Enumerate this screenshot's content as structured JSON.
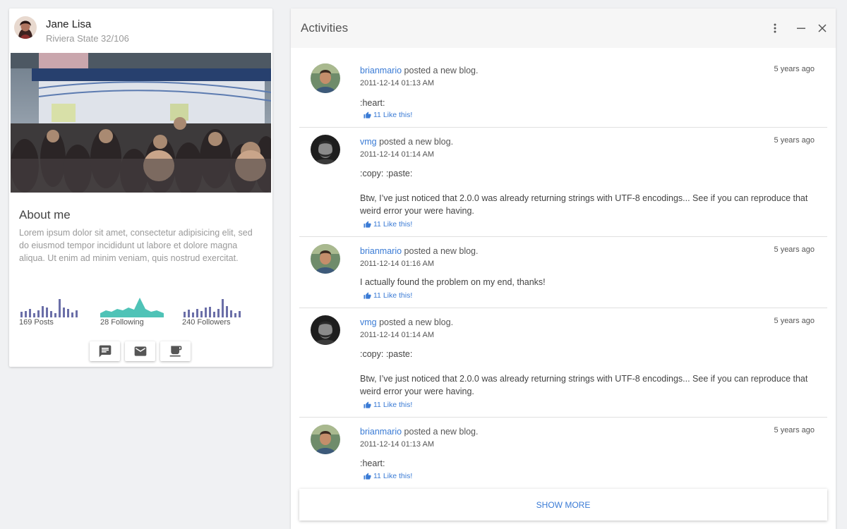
{
  "profile": {
    "name": "Jane Lisa",
    "address": "Riviera State 32/106",
    "about_title": "About me",
    "about_text": "Lorem ipsum dolor sit amet, consectetur adipisicing elit, sed do eiusmod tempor incididunt ut labore et dolore magna aliqua. Ut enim ad minim veniam, quis nostrud exercitat.",
    "stats": {
      "posts": "169 Posts",
      "following": "28 Following",
      "followers": "240 Followers"
    },
    "actions": [
      {
        "icon": "chat-icon"
      },
      {
        "icon": "mail-icon"
      },
      {
        "icon": "coffee-icon"
      }
    ]
  },
  "activities": {
    "title": "Activities",
    "items": [
      {
        "user": "brianmario",
        "action": " posted a new blog.",
        "time": "5 years ago",
        "date": "2011-12-14 01:13 AM",
        "body": ":heart:",
        "likes": "11 Like this!"
      },
      {
        "user": "vmg",
        "action": " posted a new blog.",
        "time": "5 years ago",
        "date": "2011-12-14 01:14 AM",
        "body": ":copy: :paste:",
        "body2": "Btw, I’ve just noticed that 2.0.0 was already returning strings with UTF-8 encodings... See if you can reproduce that weird error your were having.",
        "likes": "11 Like this!"
      },
      {
        "user": "brianmario",
        "action": " posted a new blog.",
        "time": "5 years ago",
        "date": "2011-12-14 01:16 AM",
        "body": "I actually found the problem on my end, thanks!",
        "likes": "11 Like this!"
      },
      {
        "user": "vmg",
        "action": " posted a new blog.",
        "time": "5 years ago",
        "date": "2011-12-14 01:14 AM",
        "body": ":copy: :paste:",
        "body2": "Btw, I’ve just noticed that 2.0.0 was already returning strings with UTF-8 encodings... See if you can reproduce that weird error your were having.",
        "likes": "11 Like this!"
      },
      {
        "user": "brianmario",
        "action": " posted a new blog.",
        "time": "5 years ago",
        "date": "2011-12-14 01:13 AM",
        "body": ":heart:",
        "likes": "11 Like this!"
      }
    ],
    "show_more": "SHOW MORE"
  },
  "colors": {
    "accent": "#3a7bd5",
    "sparkline_bars": "#6b6fa8",
    "sparkline_area": "#4fc3b7"
  }
}
